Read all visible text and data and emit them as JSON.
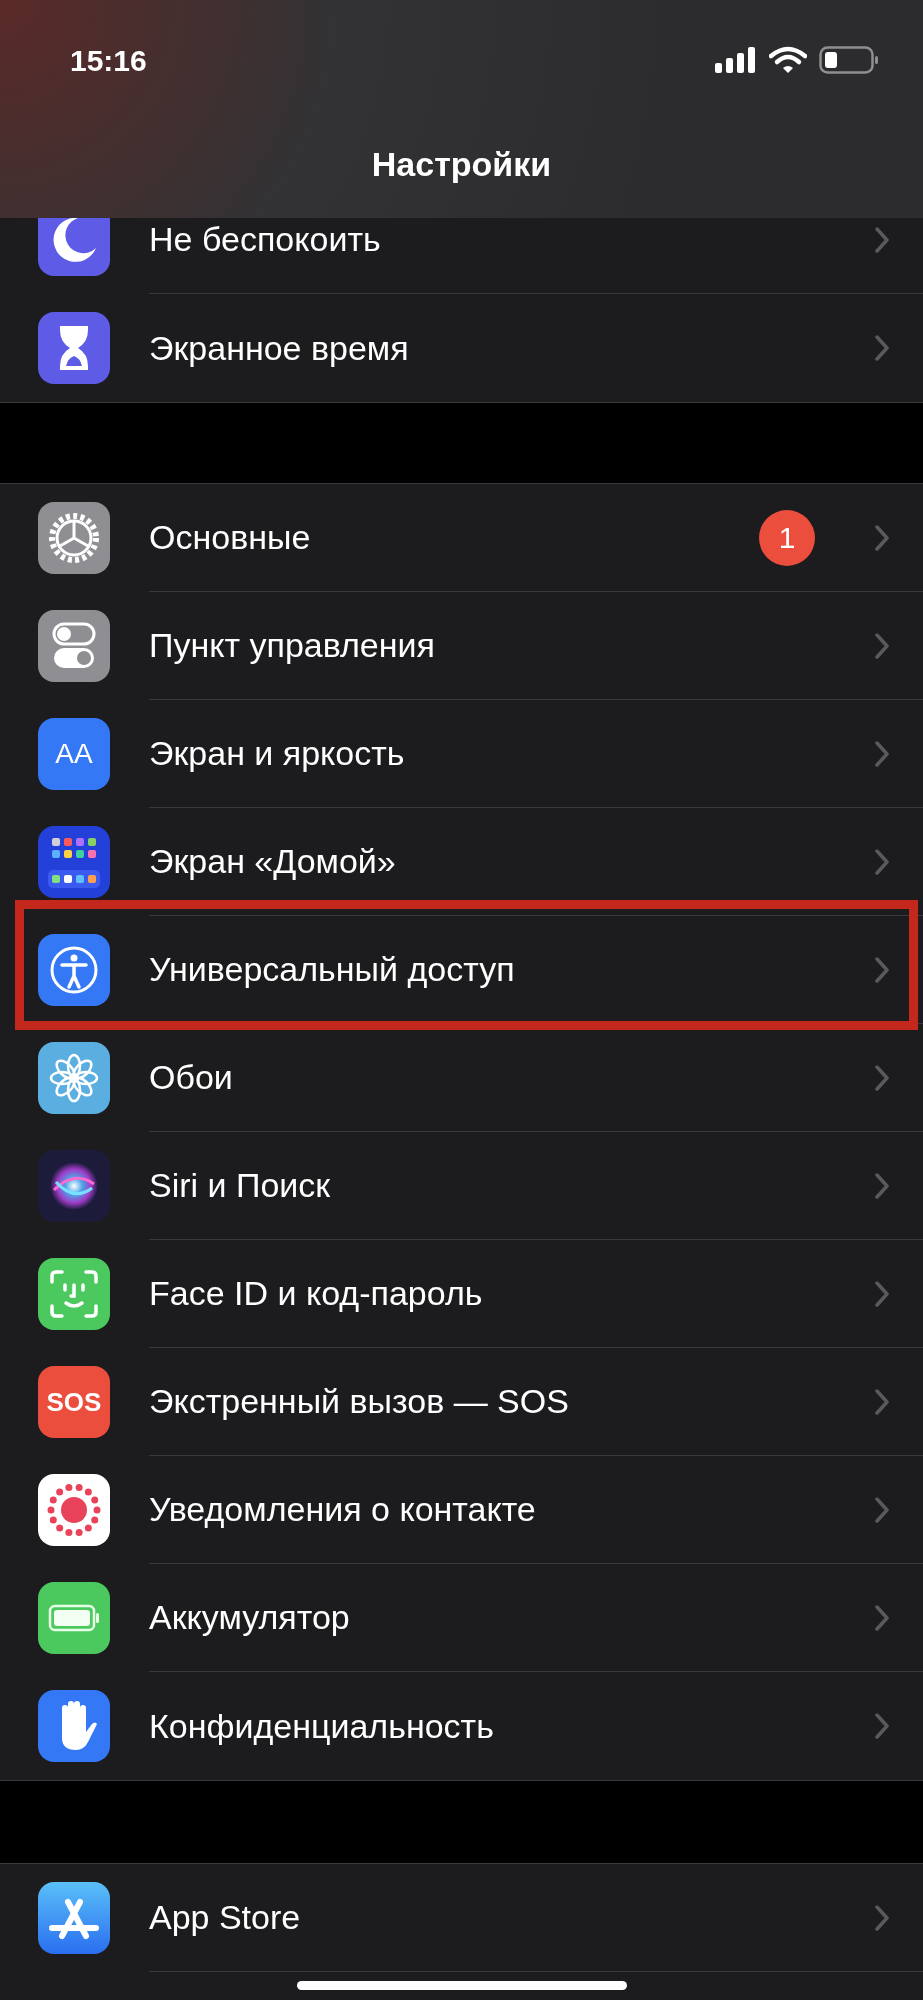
{
  "status_bar": {
    "time": "15:16"
  },
  "nav": {
    "title": "Настройки"
  },
  "groups": [
    {
      "items": [
        {
          "label": "Не беспокоить",
          "highlighted": false
        },
        {
          "label": "Экранное время",
          "highlighted": false
        }
      ]
    },
    {
      "items": [
        {
          "label": "Основные",
          "badge": "1",
          "highlighted": false
        },
        {
          "label": "Пункт управления",
          "highlighted": false
        },
        {
          "label": "Экран и яркость",
          "icon_text": "AA",
          "highlighted": false
        },
        {
          "label": "Экран «Домой»",
          "highlighted": false
        },
        {
          "label": "Универсальный доступ",
          "highlighted": true
        },
        {
          "label": "Обои",
          "highlighted": false
        },
        {
          "label": "Siri и Поиск",
          "highlighted": false
        },
        {
          "label": "Face ID и код-пароль",
          "highlighted": false
        },
        {
          "label": "Экстренный вызов — SOS",
          "icon_text": "SOS",
          "highlighted": false
        },
        {
          "label": "Уведомления о контакте",
          "highlighted": false
        },
        {
          "label": "Аккумулятор",
          "highlighted": false
        },
        {
          "label": "Конфиденциальность",
          "highlighted": false
        }
      ]
    },
    {
      "items": [
        {
          "label": "App Store",
          "highlighted": false
        }
      ]
    }
  ]
}
